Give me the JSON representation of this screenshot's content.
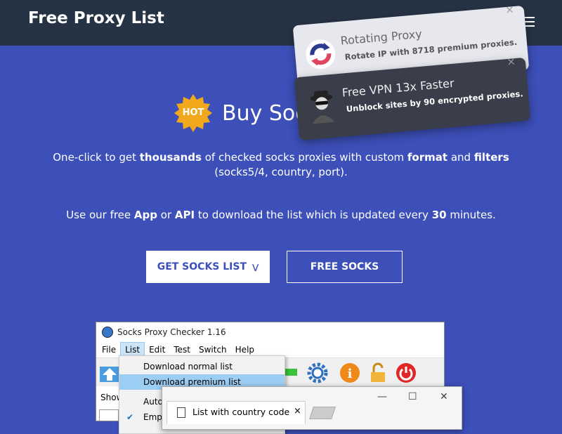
{
  "navbar": {
    "brand": "Free Proxy List",
    "menu_icon": "hamburger-icon"
  },
  "hero": {
    "badge": "HOT",
    "title": "Buy Socks Proxy",
    "desc1_parts": [
      "One-click to get ",
      "thousands",
      " of checked socks proxies with custom ",
      "format",
      " and ",
      "filters",
      " (socks5/4, country, port)."
    ],
    "desc2_parts": [
      "Use our free ",
      "App",
      " or ",
      "API",
      " to download the list which is updated every ",
      "30",
      " minutes."
    ],
    "primary_button": "GET SOCKS LIST",
    "secondary_button": "FREE SOCKS"
  },
  "notifications": [
    {
      "title": "Rotating Proxy",
      "body": "Rotate IP with 8718 premium proxies.",
      "close": "×",
      "icon": "rotate-icon"
    },
    {
      "title": "Free VPN 13x Faster",
      "body": "Unblock sites by 90 encrypted proxies.",
      "close": "×",
      "icon": "spy-icon"
    }
  ],
  "app": {
    "title": "Socks Proxy Checker 1.16",
    "menu": [
      "File",
      "List",
      "Edit",
      "Test",
      "Switch",
      "Help"
    ],
    "active_menu": "List",
    "side_label": "Show",
    "dropdown": {
      "items": [
        "Download normal list",
        "Download premium list",
        "Auto",
        "Empt"
      ],
      "highlighted": "Download premium list",
      "checked": "Empt"
    },
    "subwindow": {
      "tab_label": "List with country code",
      "tab_close": "×",
      "min": "—",
      "max": "☐",
      "close": "✕"
    }
  },
  "colors": {
    "background": "#3d4fb8",
    "navbar": "#263345",
    "badge": "#f2a81d"
  }
}
